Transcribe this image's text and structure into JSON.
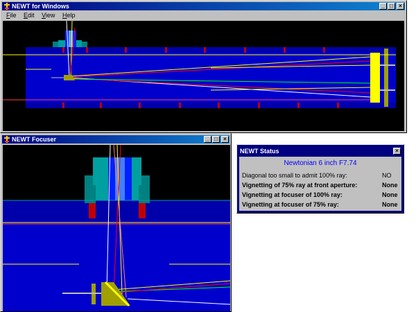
{
  "main_window": {
    "title": "NEWT for Windows",
    "menu": [
      "File",
      "Edit",
      "View",
      "Help"
    ]
  },
  "focuser_window": {
    "title": "NEWT Focuser"
  },
  "status_window": {
    "title": "NEWT Status",
    "close_label": "×",
    "design": "Newtonian 6 inch F7.74",
    "rows": [
      {
        "label": "Diagonal too small to admit 100% ray:",
        "value": "NO"
      },
      {
        "label": "Vignetting of 75% ray at front aperture:",
        "value": "None"
      },
      {
        "label": "Vignetting at focuser of 100% ray:",
        "value": "None"
      },
      {
        "label": "Vignetting at focuser of 75% ray:",
        "value": "None"
      }
    ]
  },
  "colors": {
    "tube": "#0000cc",
    "focuser_teal": "#00a0a0",
    "ray_red": "#ff0000",
    "ray_yellow": "#ffff00",
    "mirror": "#ffff00",
    "diagonal": "#a0a000"
  }
}
